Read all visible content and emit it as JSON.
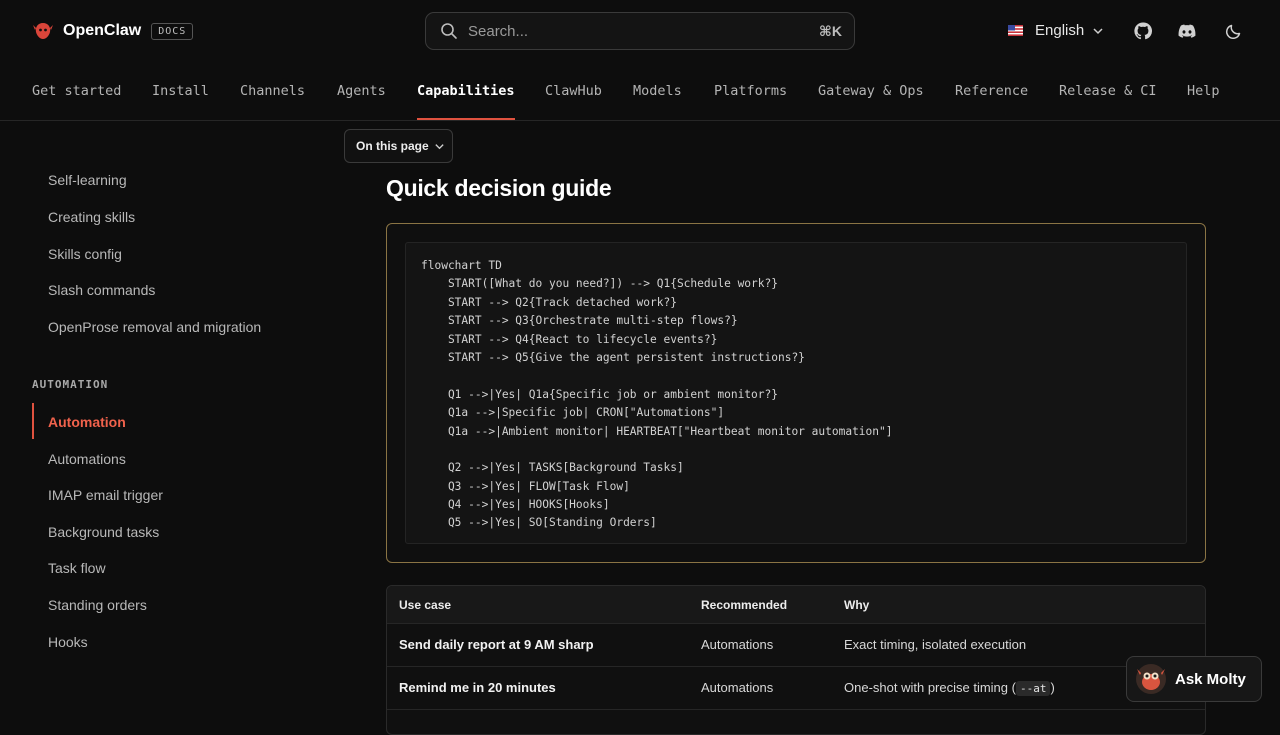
{
  "header": {
    "brand": "OpenClaw",
    "docs_badge": "DOCS",
    "search_placeholder": "Search...",
    "search_shortcut": "⌘K",
    "language": "English"
  },
  "nav_tabs": [
    {
      "label": "Get started",
      "active": false
    },
    {
      "label": "Install",
      "active": false
    },
    {
      "label": "Channels",
      "active": false
    },
    {
      "label": "Agents",
      "active": false
    },
    {
      "label": "Capabilities",
      "active": true
    },
    {
      "label": "ClawHub",
      "active": false
    },
    {
      "label": "Models",
      "active": false
    },
    {
      "label": "Platforms",
      "active": false
    },
    {
      "label": "Gateway & Ops",
      "active": false
    },
    {
      "label": "Reference",
      "active": false
    },
    {
      "label": "Release & CI",
      "active": false
    },
    {
      "label": "Help",
      "active": false
    }
  ],
  "sidebar": {
    "items_top": [
      "Self-learning",
      "Creating skills",
      "Skills config",
      "Slash commands",
      "OpenProse removal and migration"
    ],
    "section_title": "AUTOMATION",
    "items_automation": [
      "Automation",
      "Automations",
      "IMAP email trigger",
      "Background tasks",
      "Task flow",
      "Standing orders",
      "Hooks"
    ],
    "active_item": "Automation"
  },
  "on_this_page": "On this page",
  "main": {
    "title": "Quick decision guide",
    "code_lines": [
      "flowchart TD",
      "    START([What do you need?]) --> Q1{Schedule work?}",
      "    START --> Q2{Track detached work?}",
      "    START --> Q3{Orchestrate multi-step flows?}",
      "    START --> Q4{React to lifecycle events?}",
      "    START --> Q5{Give the agent persistent instructions?}",
      "",
      "    Q1 -->|Yes| Q1a{Specific job or ambient monitor?}",
      "    Q1a -->|Specific job| CRON[\"Automations\"]",
      "    Q1a -->|Ambient monitor| HEARTBEAT[\"Heartbeat monitor automation\"]",
      "",
      "    Q2 -->|Yes| TASKS[Background Tasks]",
      "    Q3 -->|Yes| FLOW[Task Flow]",
      "    Q4 -->|Yes| HOOKS[Hooks]",
      "    Q5 -->|Yes| SO[Standing Orders]"
    ],
    "table": {
      "headers": [
        "Use case",
        "Recommended",
        "Why"
      ],
      "rows": [
        {
          "use_case": "Send daily report at 9 AM sharp",
          "recommended": "Automations",
          "why": "Exact timing, isolated execution"
        },
        {
          "use_case": "Remind me in 20 minutes",
          "recommended": "Automations",
          "why_prefix": "One-shot with precise timing (",
          "why_code": "--at",
          "why_suffix": ")"
        }
      ]
    }
  },
  "ask_molty": "Ask Molty",
  "colors": {
    "accent": "#e0523f",
    "code_border": "#8a7444",
    "background": "#0d0d0d"
  }
}
